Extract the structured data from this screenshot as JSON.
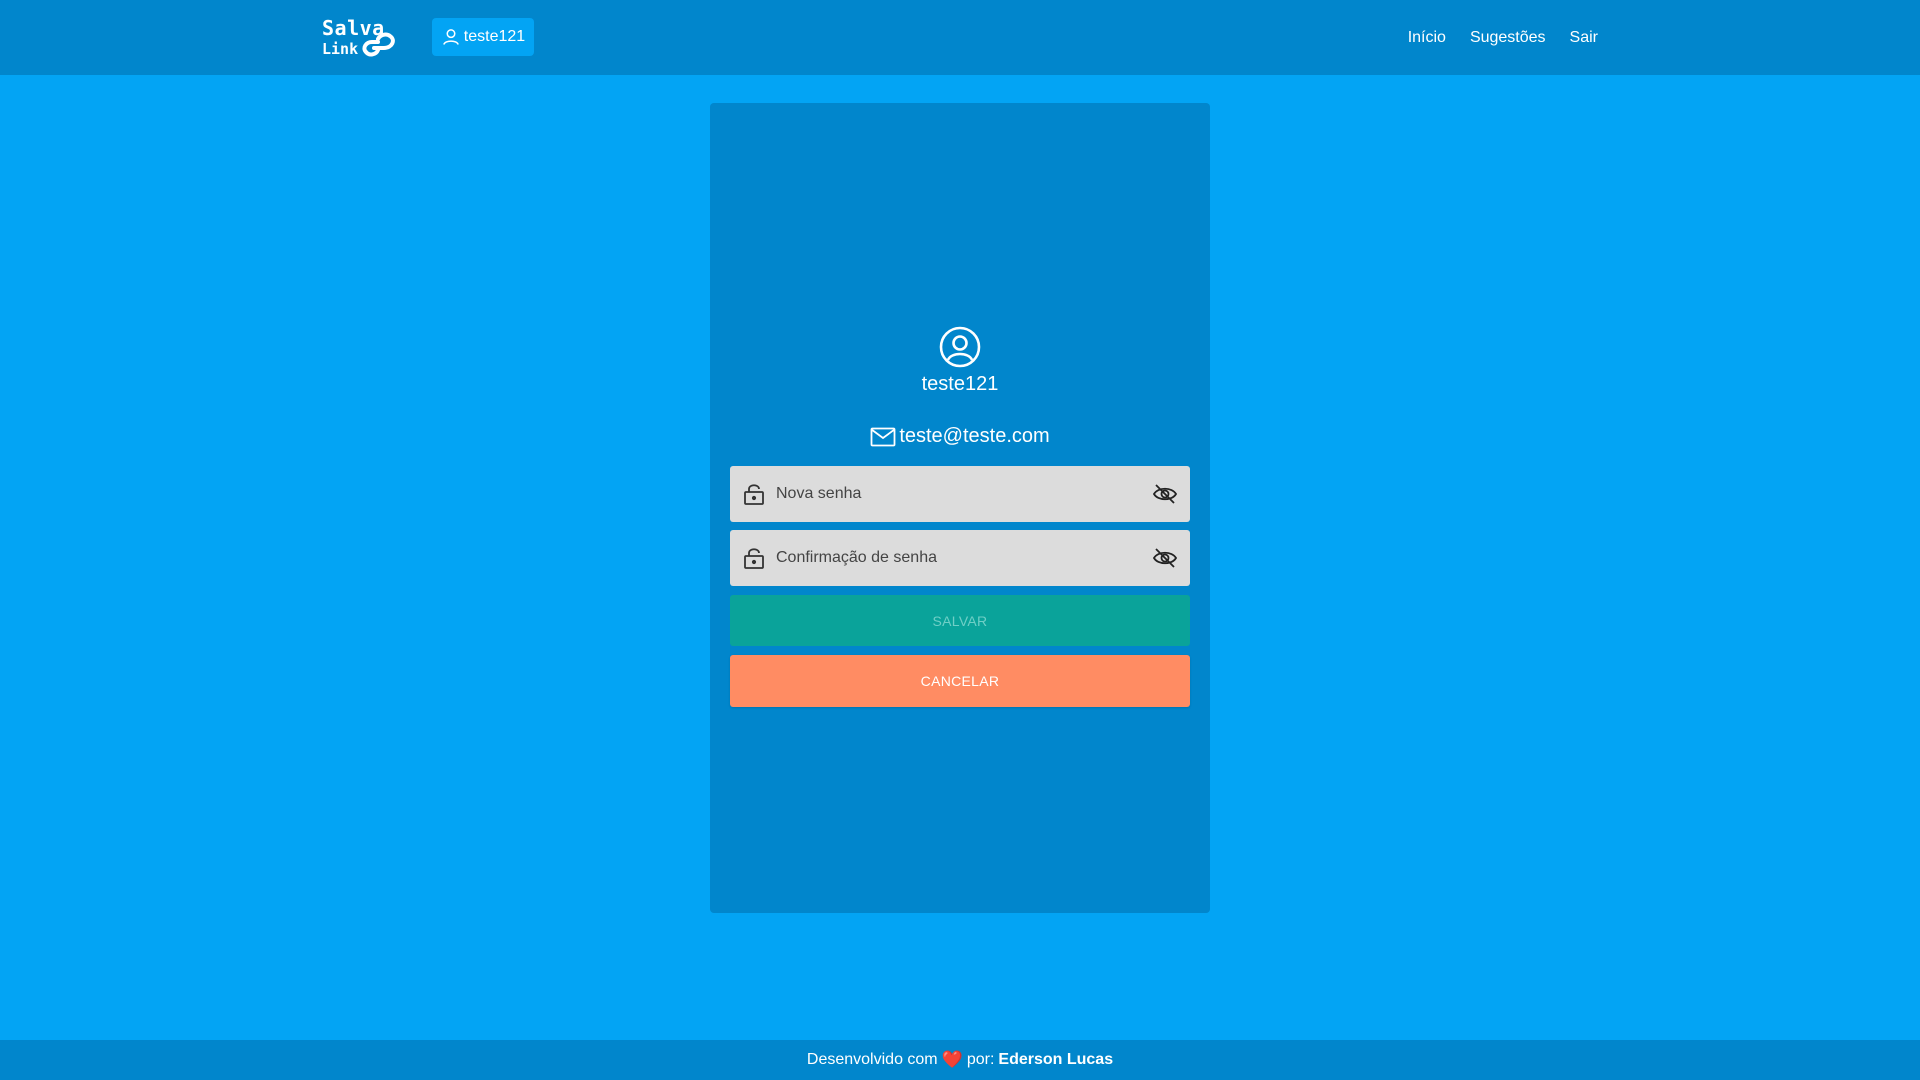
{
  "header": {
    "logo_line1": "Salva",
    "logo_line2": "Link",
    "user_chip_label": "teste121",
    "nav": [
      {
        "label": "Início"
      },
      {
        "label": "Sugestões"
      },
      {
        "label": "Sair"
      }
    ]
  },
  "profile": {
    "icon": "user-circle-icon",
    "username": "teste121",
    "email_icon": "mail-icon",
    "email": "teste@teste.com",
    "new_password": {
      "placeholder": "Nova senha",
      "value": "",
      "icon": "lock-icon",
      "toggle_icon": "eye-off-icon"
    },
    "confirm_password": {
      "placeholder": "Confirmação de senha",
      "value": "",
      "icon": "lock-icon",
      "toggle_icon": "eye-off-icon"
    },
    "save_label": "SALVAR",
    "cancel_label": "CANCELAR"
  },
  "footer": {
    "prefix": "Desenvolvido com",
    "heart": "❤️",
    "middle": "por:",
    "author": "Ederson Lucas"
  },
  "colors": {
    "page_bg": "#03a4f4",
    "bar_bg": "#0186cc",
    "save_bg": "#0aa39a",
    "cancel_bg": "#ff8c63",
    "field_bg": "#dcdcdc"
  }
}
